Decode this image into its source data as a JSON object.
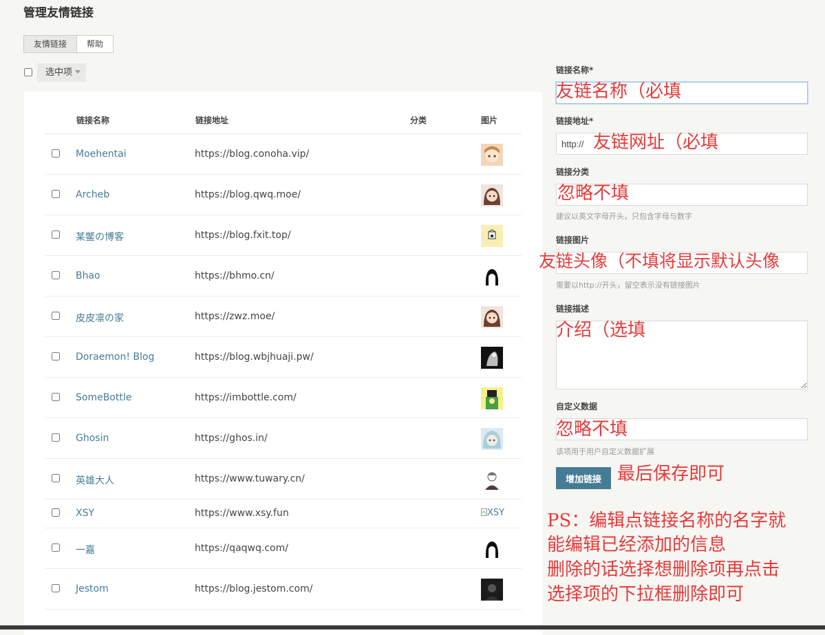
{
  "page": {
    "title": "管理友情链接"
  },
  "tabs": [
    {
      "label": "友情链接",
      "active": true
    },
    {
      "label": "帮助",
      "active": false
    }
  ],
  "bulk": {
    "label": "选中项"
  },
  "table": {
    "headers": {
      "name": "链接名称",
      "url": "链接地址",
      "category": "分类",
      "image": "图片"
    },
    "rows": [
      {
        "name": "Moehentai",
        "url": "https://blog.conoha.vip/",
        "thumb": "avatar-anime-girl-orange"
      },
      {
        "name": "Archeb",
        "url": "https://blog.qwq.moe/",
        "thumb": "avatar-anime-girl-brown"
      },
      {
        "name": "某鳖の博客",
        "url": "https://blog.fxit.top/",
        "thumb": "avatar-yellow-box"
      },
      {
        "name": "Bhao",
        "url": "https://bhmo.cn/",
        "thumb": "avatar-black-hair-girl"
      },
      {
        "name": "皮皮凛の家",
        "url": "https://zwz.moe/",
        "thumb": "avatar-anime-girl-brown"
      },
      {
        "name": "Doraemon! Blog",
        "url": "https://blog.wbjhuaji.pw/",
        "thumb": "avatar-dark-figure"
      },
      {
        "name": "SomeBottle",
        "url": "https://imbottle.com/",
        "thumb": "avatar-yellow-green"
      },
      {
        "name": "Ghosin",
        "url": "https://ghos.in/",
        "thumb": "avatar-silver-hair-girl"
      },
      {
        "name": "英雄大人",
        "url": "https://www.tuwary.cn/",
        "thumb": "avatar-sketch-boy"
      },
      {
        "name": "XSY",
        "url": "https://www.xsy.fun",
        "thumb": "broken-image",
        "image_alt": "XSY"
      },
      {
        "name": "一嘉",
        "url": "https://qaqwq.com/",
        "thumb": "avatar-black-hair-girl"
      },
      {
        "name": "Jestom",
        "url": "https://blog.jestom.com/",
        "thumb": "avatar-dark-portrait"
      }
    ]
  },
  "form": {
    "name_label": "链接名称*",
    "url_label": "链接地址*",
    "url_value": "http://",
    "category_label": "链接分类",
    "category_hint": "建议以英文字母开头，只包含字母与数字",
    "image_label": "链接图片",
    "image_hint": "需要以http://开头，留空表示没有链接图片",
    "desc_label": "链接描述",
    "custom_label": "自定义数据",
    "custom_hint": "该项用于用户自定义数据扩展",
    "submit_label": "增加链接"
  },
  "annotations": {
    "name": "友链名称（必填",
    "url": "友链网址（必填",
    "category": "忽略不填",
    "image": "友链头像（不填将显示默认头像",
    "desc": "介绍（选填",
    "custom": "忽略不填",
    "save": "最后保存即可",
    "ps1": "PS：编辑点链接名称的名字就",
    "ps2": "能编辑已经添加的信息",
    "ps3": "删除的话选择想删除项再点击",
    "ps4": "选择项的下拉框删除即可"
  },
  "colors": {
    "accent": "#467b96",
    "annotation": "#e53b3b",
    "background": "#f6f6f3"
  }
}
